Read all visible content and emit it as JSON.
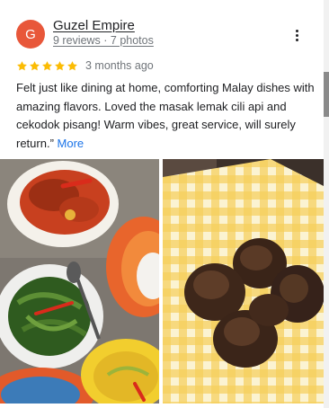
{
  "review": {
    "avatar_letter": "G",
    "author": "Guzel Empire",
    "meta": "9 reviews · 7 photos",
    "rating": 5,
    "max_rating": 5,
    "time": "3 months ago",
    "text": "Felt just like dining at home, comforting Malay dishes with amazing flavors. Loved the masak lemak cili api and cekodok pisang! Warm vibes, great service, will surely return.” ",
    "more_label": "More",
    "photos": [
      {
        "icon": "photo-malay-dishes"
      },
      {
        "icon": "photo-cekodok-pisang"
      }
    ]
  },
  "colors": {
    "avatar": "#e8573a",
    "star": "#fbbc04",
    "link": "#1a73e8",
    "secondary_text": "#70757a"
  }
}
